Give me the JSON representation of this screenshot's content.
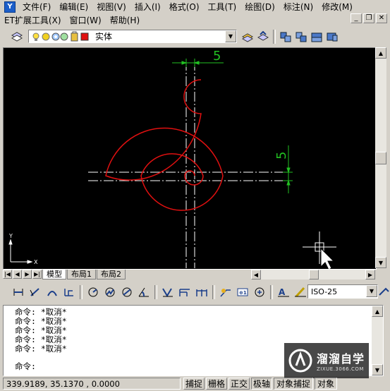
{
  "menu": {
    "row1": [
      "文件(F)",
      "编辑(E)",
      "视图(V)",
      "插入(I)",
      "格式(O)",
      "工具(T)",
      "绘图(D)",
      "标注(N)",
      "修改(M)"
    ],
    "row2": [
      "ET扩展工具(X)",
      "窗口(W)",
      "帮助(H)"
    ]
  },
  "layer": {
    "name": "实体",
    "swatch_color": "#e01010"
  },
  "drawing": {
    "dim_top": "5",
    "dim_right": "5",
    "ucs_y": "Y",
    "ucs_x": "X",
    "curve_color": "#e01010",
    "center_line_color": "#ffffff",
    "dim_color": "#22c022"
  },
  "tabs": [
    "模型",
    "布局1",
    "布局2"
  ],
  "dimstyle": {
    "value": "ISO-25"
  },
  "command": {
    "history": [
      "命令: *取消*",
      "命令: *取消*",
      "命令: *取消*",
      "命令: *取消*",
      "命令: *取消*"
    ],
    "prompt": "命令:"
  },
  "status": {
    "coords": "339.9189, 35.1370 , 0.0000",
    "buttons": [
      "捕捉",
      "栅格",
      "正交",
      "极轴",
      "对象捕捉",
      "对象"
    ]
  },
  "watermark": {
    "title": "溜溜自学",
    "url": "ZIXUE.3066.COM"
  }
}
